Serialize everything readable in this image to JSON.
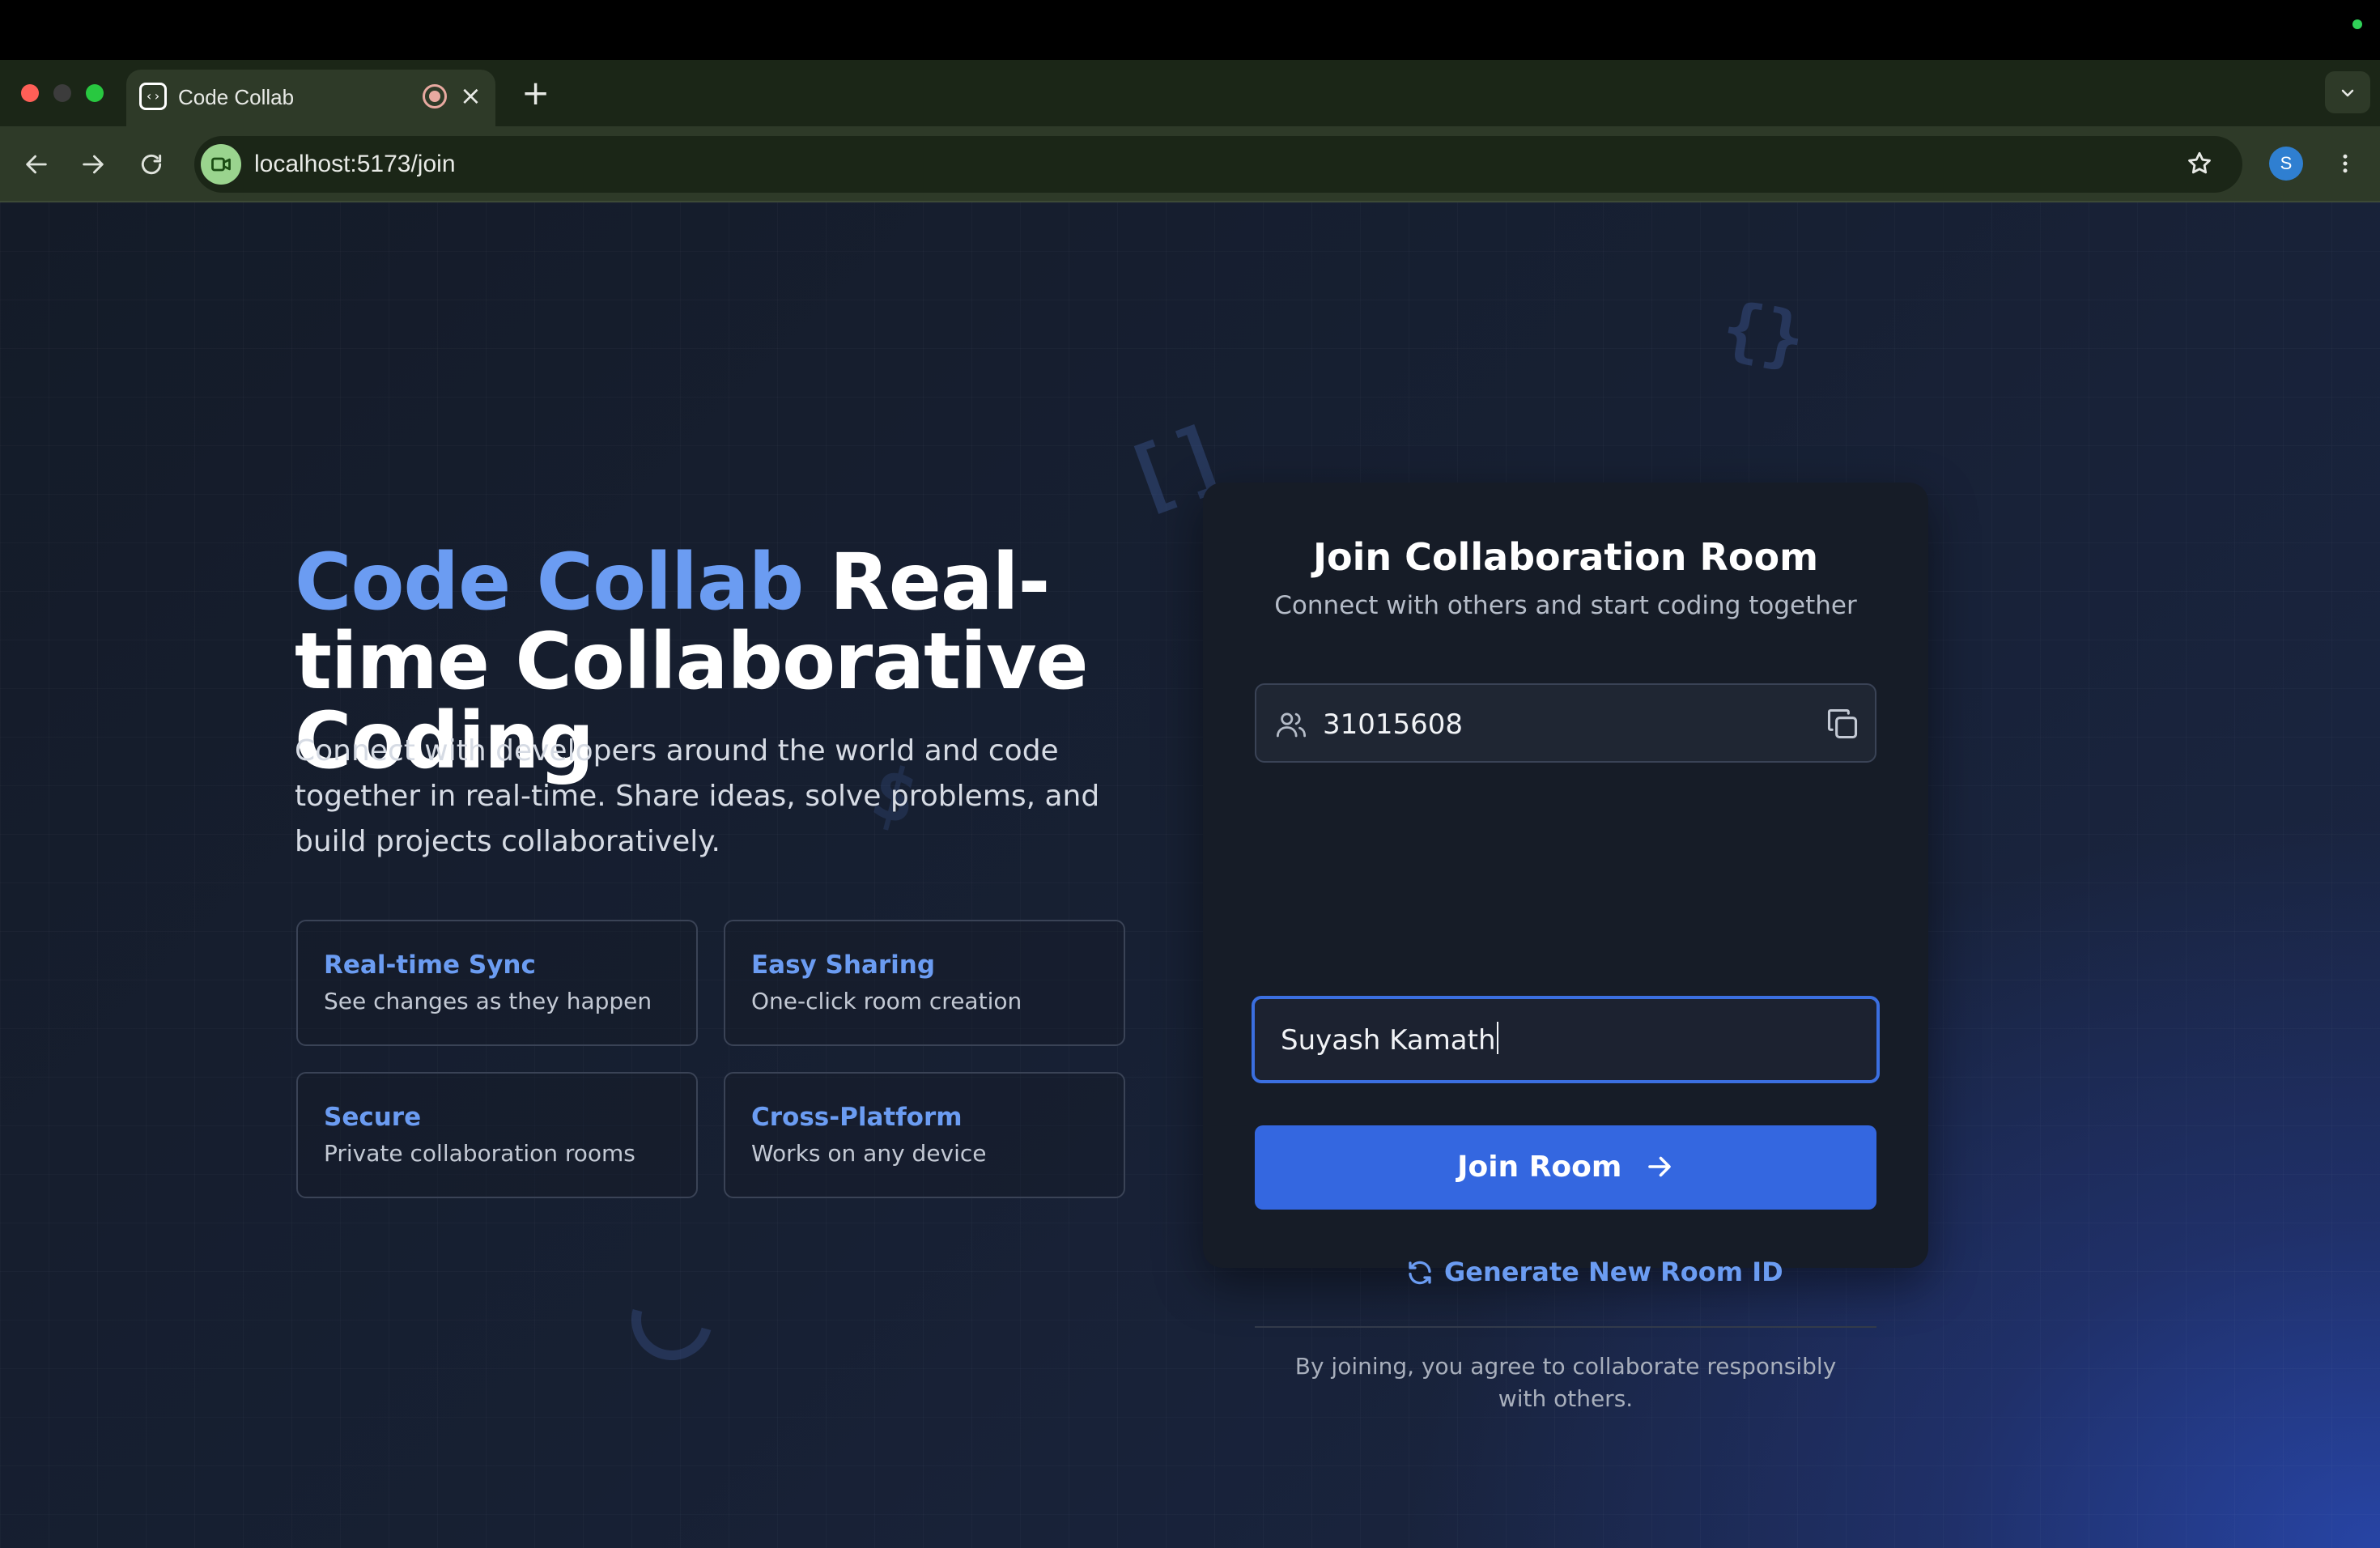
{
  "browser": {
    "tab_title": "Code Collab",
    "favicon_glyph": "‹›",
    "new_tab_glyph": "+",
    "close_glyph": "×",
    "url": "localhost:5173/join",
    "profile_initial": "S",
    "icons": {
      "back": "arrow-left-icon",
      "forward": "arrow-right-icon",
      "reload": "reload-icon",
      "star": "bookmark-star-icon",
      "menu": "kebab-menu-icon",
      "tab_menu": "chevron-down-icon"
    }
  },
  "hero": {
    "brand": "Code Collab",
    "title_rest": "Real-time Collaborative Coding",
    "description": "Connect with developers around the world and code together in real-time. Share ideas, solve problems, and build projects collaboratively."
  },
  "features": [
    {
      "title": "Real-time Sync",
      "subtitle": "See changes as they happen"
    },
    {
      "title": "Easy Sharing",
      "subtitle": "One-click room creation"
    },
    {
      "title": "Secure",
      "subtitle": "Private collaboration rooms"
    },
    {
      "title": "Cross-Platform",
      "subtitle": "Works on any device"
    }
  ],
  "card": {
    "title": "Join Collaboration Room",
    "subtitle": "Connect with others and start coding together",
    "room_id": "31015608",
    "username": "Suyash Kamath",
    "join_label": "Join Room",
    "generate_label": "Generate New Room ID",
    "footer": "By joining, you agree to collaborate responsibly with others."
  },
  "colors": {
    "accent": "#6b9cf2",
    "primary_button": "#3467e0",
    "card_bg": "#161c27"
  }
}
